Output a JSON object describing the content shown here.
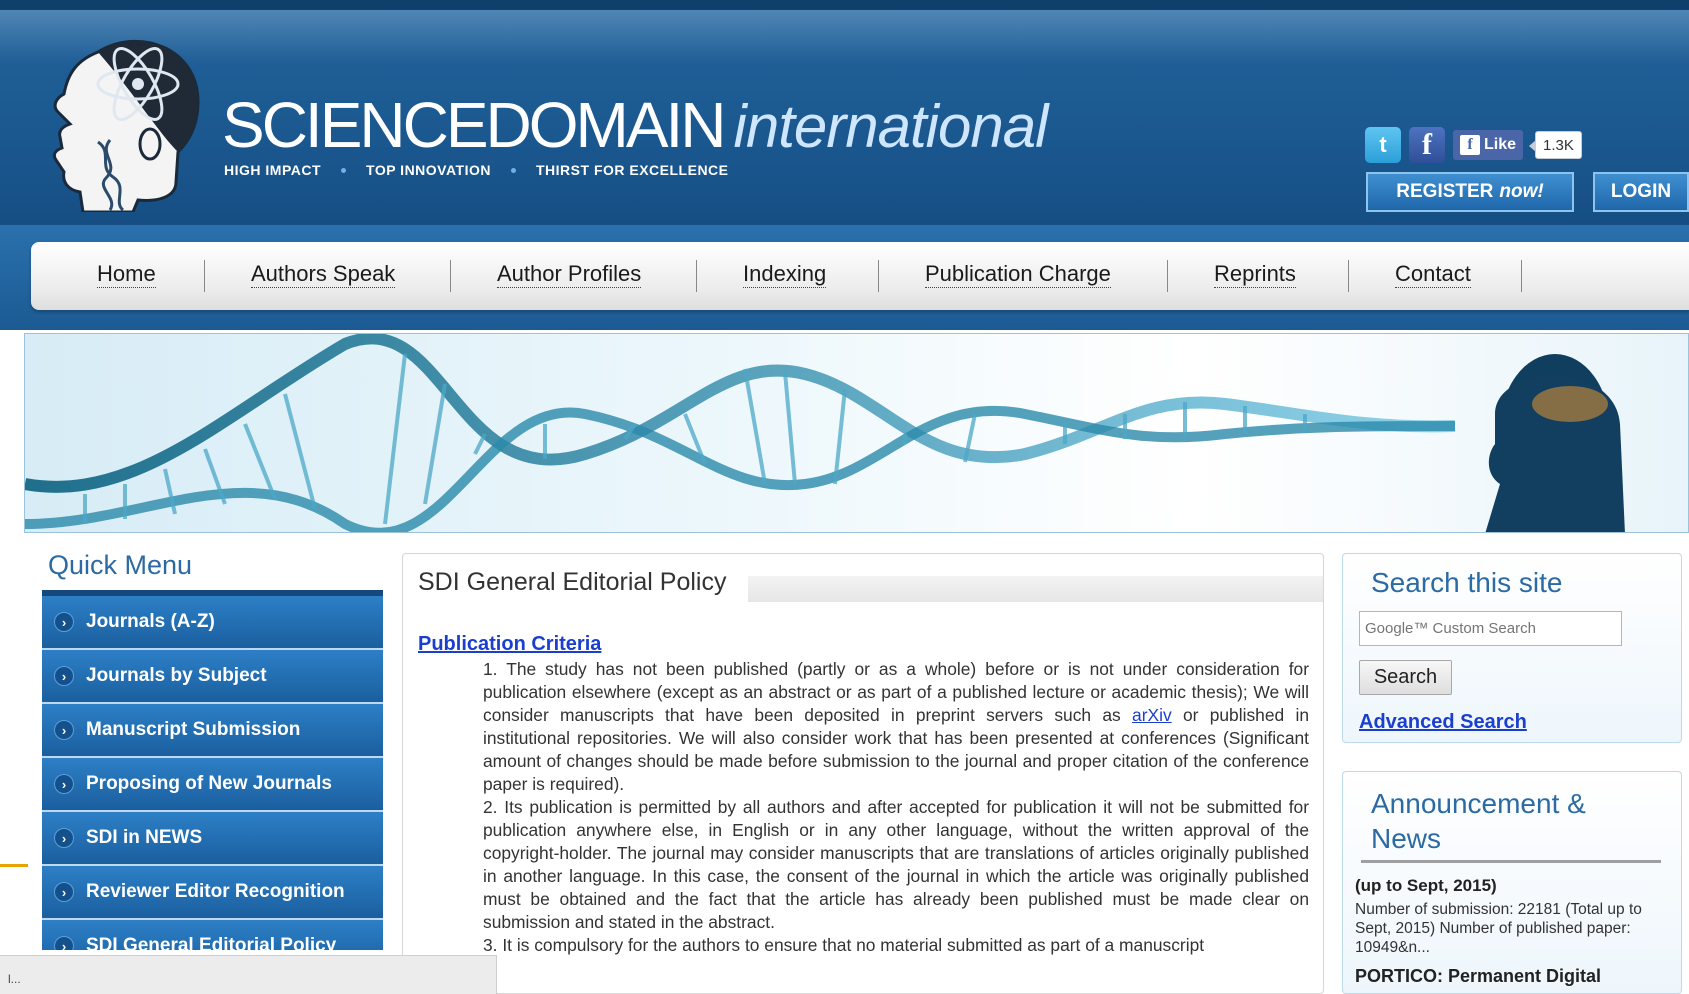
{
  "header": {
    "brand_main": "SCIENCEDOMAIN",
    "brand_suffix": "international",
    "taglines": [
      "HIGH IMPACT",
      "TOP INNOVATION",
      "THIRST FOR EXCELLENCE"
    ],
    "social": {
      "twitter_icon": "twitter-icon",
      "facebook_icon": "facebook-icon",
      "like_label": "Like",
      "like_count": "1.3K"
    },
    "register_label": "REGISTER",
    "register_suffix": "now!",
    "login_label": "LOGIN"
  },
  "nav": {
    "items": [
      "Home",
      "Authors Speak",
      "Author Profiles",
      "Indexing",
      "Publication Charge",
      "Reprints",
      "Contact"
    ]
  },
  "quick_menu": {
    "title": "Quick Menu",
    "items": [
      "Journals (A-Z)",
      "Journals by Subject",
      "Manuscript Submission",
      "Proposing of New Journals",
      "SDI in NEWS",
      "Reviewer Editor Recognition",
      "SDI General Editorial Policy"
    ]
  },
  "content": {
    "title": "SDI General Editorial Policy",
    "section_heading": "Publication Criteria",
    "p1_before_link": "1. The study has not been published (partly or as a whole) before or is not under consideration for publication elsewhere (except as an abstract or as part of a published lecture or academic thesis); We will consider manuscripts that have been deposited in preprint servers such as",
    "p1_link": "arXiv",
    "p1_after_link": "or published in institutional repositories. We will also consider work that has been presented at conferences (Significant amount of changes should be made before submission to the journal and proper citation of the conference paper is required).",
    "p2": "2. Its publication is permitted by all authors and after accepted for publication it will not be submitted for publication anywhere else, in English or in any other language, without the written approval of the copyright-holder. The journal may consider manuscripts that are translations of articles originally published in another language. In this case, the consent of the journal in which the article was originally published must be obtained and the fact that the article has already been published must be made clear on submission and stated in the abstract.",
    "p3": "3. It is compulsory for the authors to ensure that no material submitted as part of a manuscript"
  },
  "search": {
    "title": "Search this site",
    "placeholder": "Google™ Custom Search",
    "button_label": "Search",
    "advanced_label": "Advanced Search"
  },
  "news": {
    "title": "Announcement & News",
    "period": "(up to Sept, 2015)",
    "body": "Number of submission: 22181 (Total up to Sept, 2015) Number of published paper: 10949&n...",
    "portico": "PORTICO: Permanent Digital"
  },
  "status_bar": {
    "text": "l..."
  },
  "colors": {
    "header_blue": "#1b5890",
    "menu_blue": "#2d7fc6",
    "title_blue": "#2b6aa3",
    "link_blue": "#1a3fcf"
  }
}
